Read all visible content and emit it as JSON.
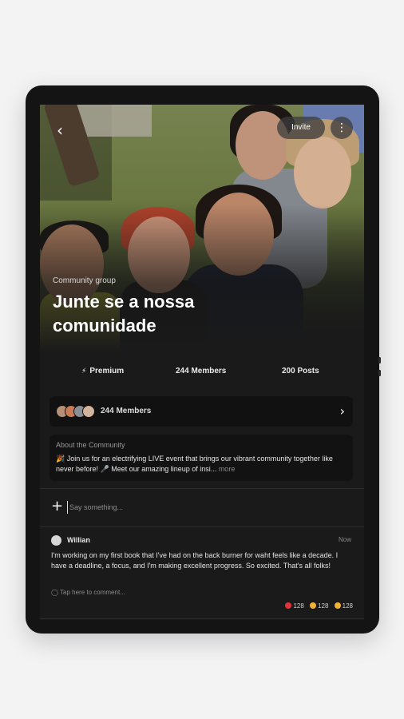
{
  "header": {
    "back_icon": "chevron-left-icon",
    "invite_label": "Invite",
    "more_icon": "more-vertical-icon"
  },
  "group": {
    "kind": "Community group",
    "title": "Junte se a nossa comunidade"
  },
  "stats": {
    "premium": "Premium",
    "members": "244 Members",
    "posts": "200 Posts"
  },
  "members_row": {
    "label": "244 Members"
  },
  "about": {
    "title": "About the Community",
    "text": "🎉 Join us for an electrifying LIVE event that brings our vibrant  community together like never before! 🎤 Meet our amazing lineup of  insi...",
    "more": " more"
  },
  "compose": {
    "placeholder": "Say something..."
  },
  "post": {
    "author": "Willian",
    "time": "Now",
    "body": "I'm working on my first book that I've had on the back burner for waht feels like a decade. I have a deadline, a focus, and I'm making excellent progress. So excited. That's all folks!",
    "comment_hint": "◯ Tap here to comment...",
    "reactions": [
      {
        "icon": "heart-icon",
        "color": "#e0343a",
        "count": "128"
      },
      {
        "icon": "thumbs-up-icon",
        "color": "#f2b233",
        "count": "128"
      },
      {
        "icon": "smile-icon",
        "color": "#f2b233",
        "count": "128"
      }
    ]
  }
}
